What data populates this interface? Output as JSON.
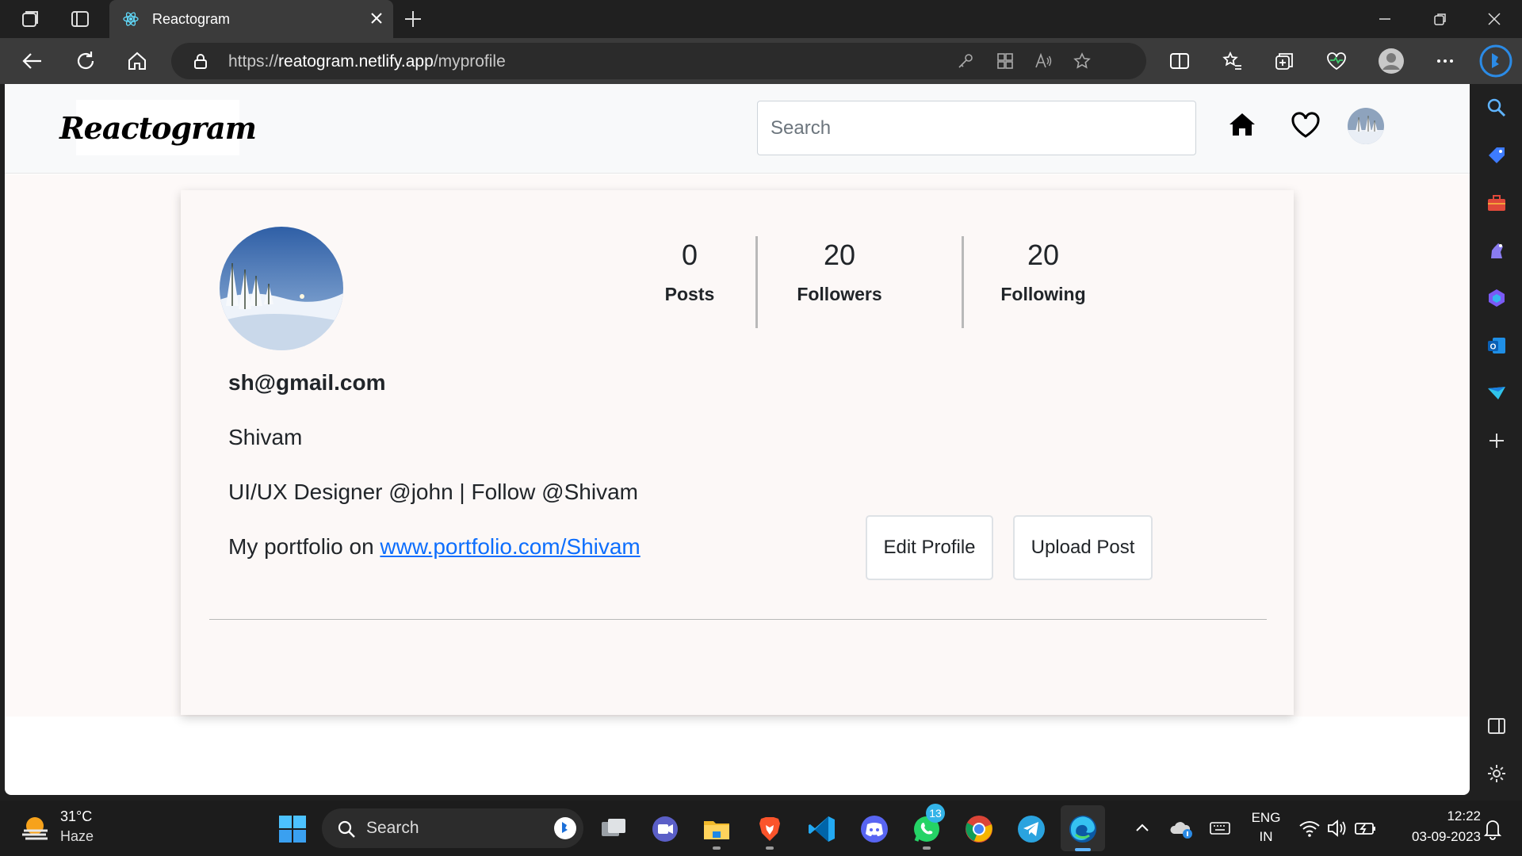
{
  "browser": {
    "tab_title": "Reactogram",
    "url_prefix": "https://",
    "url_host": "reatogram.netlify.app",
    "url_path": "/myprofile"
  },
  "app": {
    "logo": "Reactogram",
    "search_placeholder": "Search"
  },
  "profile": {
    "email": "sh@gmail.com",
    "name": "Shivam",
    "bio": "UI/UX Designer @john | Follow @Shivam",
    "portfolio_prefix": "My portfolio on ",
    "portfolio_link": "www.portfolio.com/Shivam",
    "stats": [
      {
        "value": "0",
        "label": "Posts"
      },
      {
        "value": "20",
        "label": "Followers"
      },
      {
        "value": "20",
        "label": "Following"
      }
    ],
    "edit_button": "Edit Profile",
    "upload_button": "Upload Post"
  },
  "taskbar": {
    "weather_temp": "31°C",
    "weather_desc": "Haze",
    "search_label": "Search",
    "whatsapp_badge": "13",
    "lang_top": "ENG",
    "lang_bottom": "IN",
    "time": "12:22",
    "date": "03-09-2023"
  },
  "colors": {
    "link": "#0d6efd",
    "accent_blue": "#0078d4",
    "page_bg": "#fdf9f8"
  }
}
